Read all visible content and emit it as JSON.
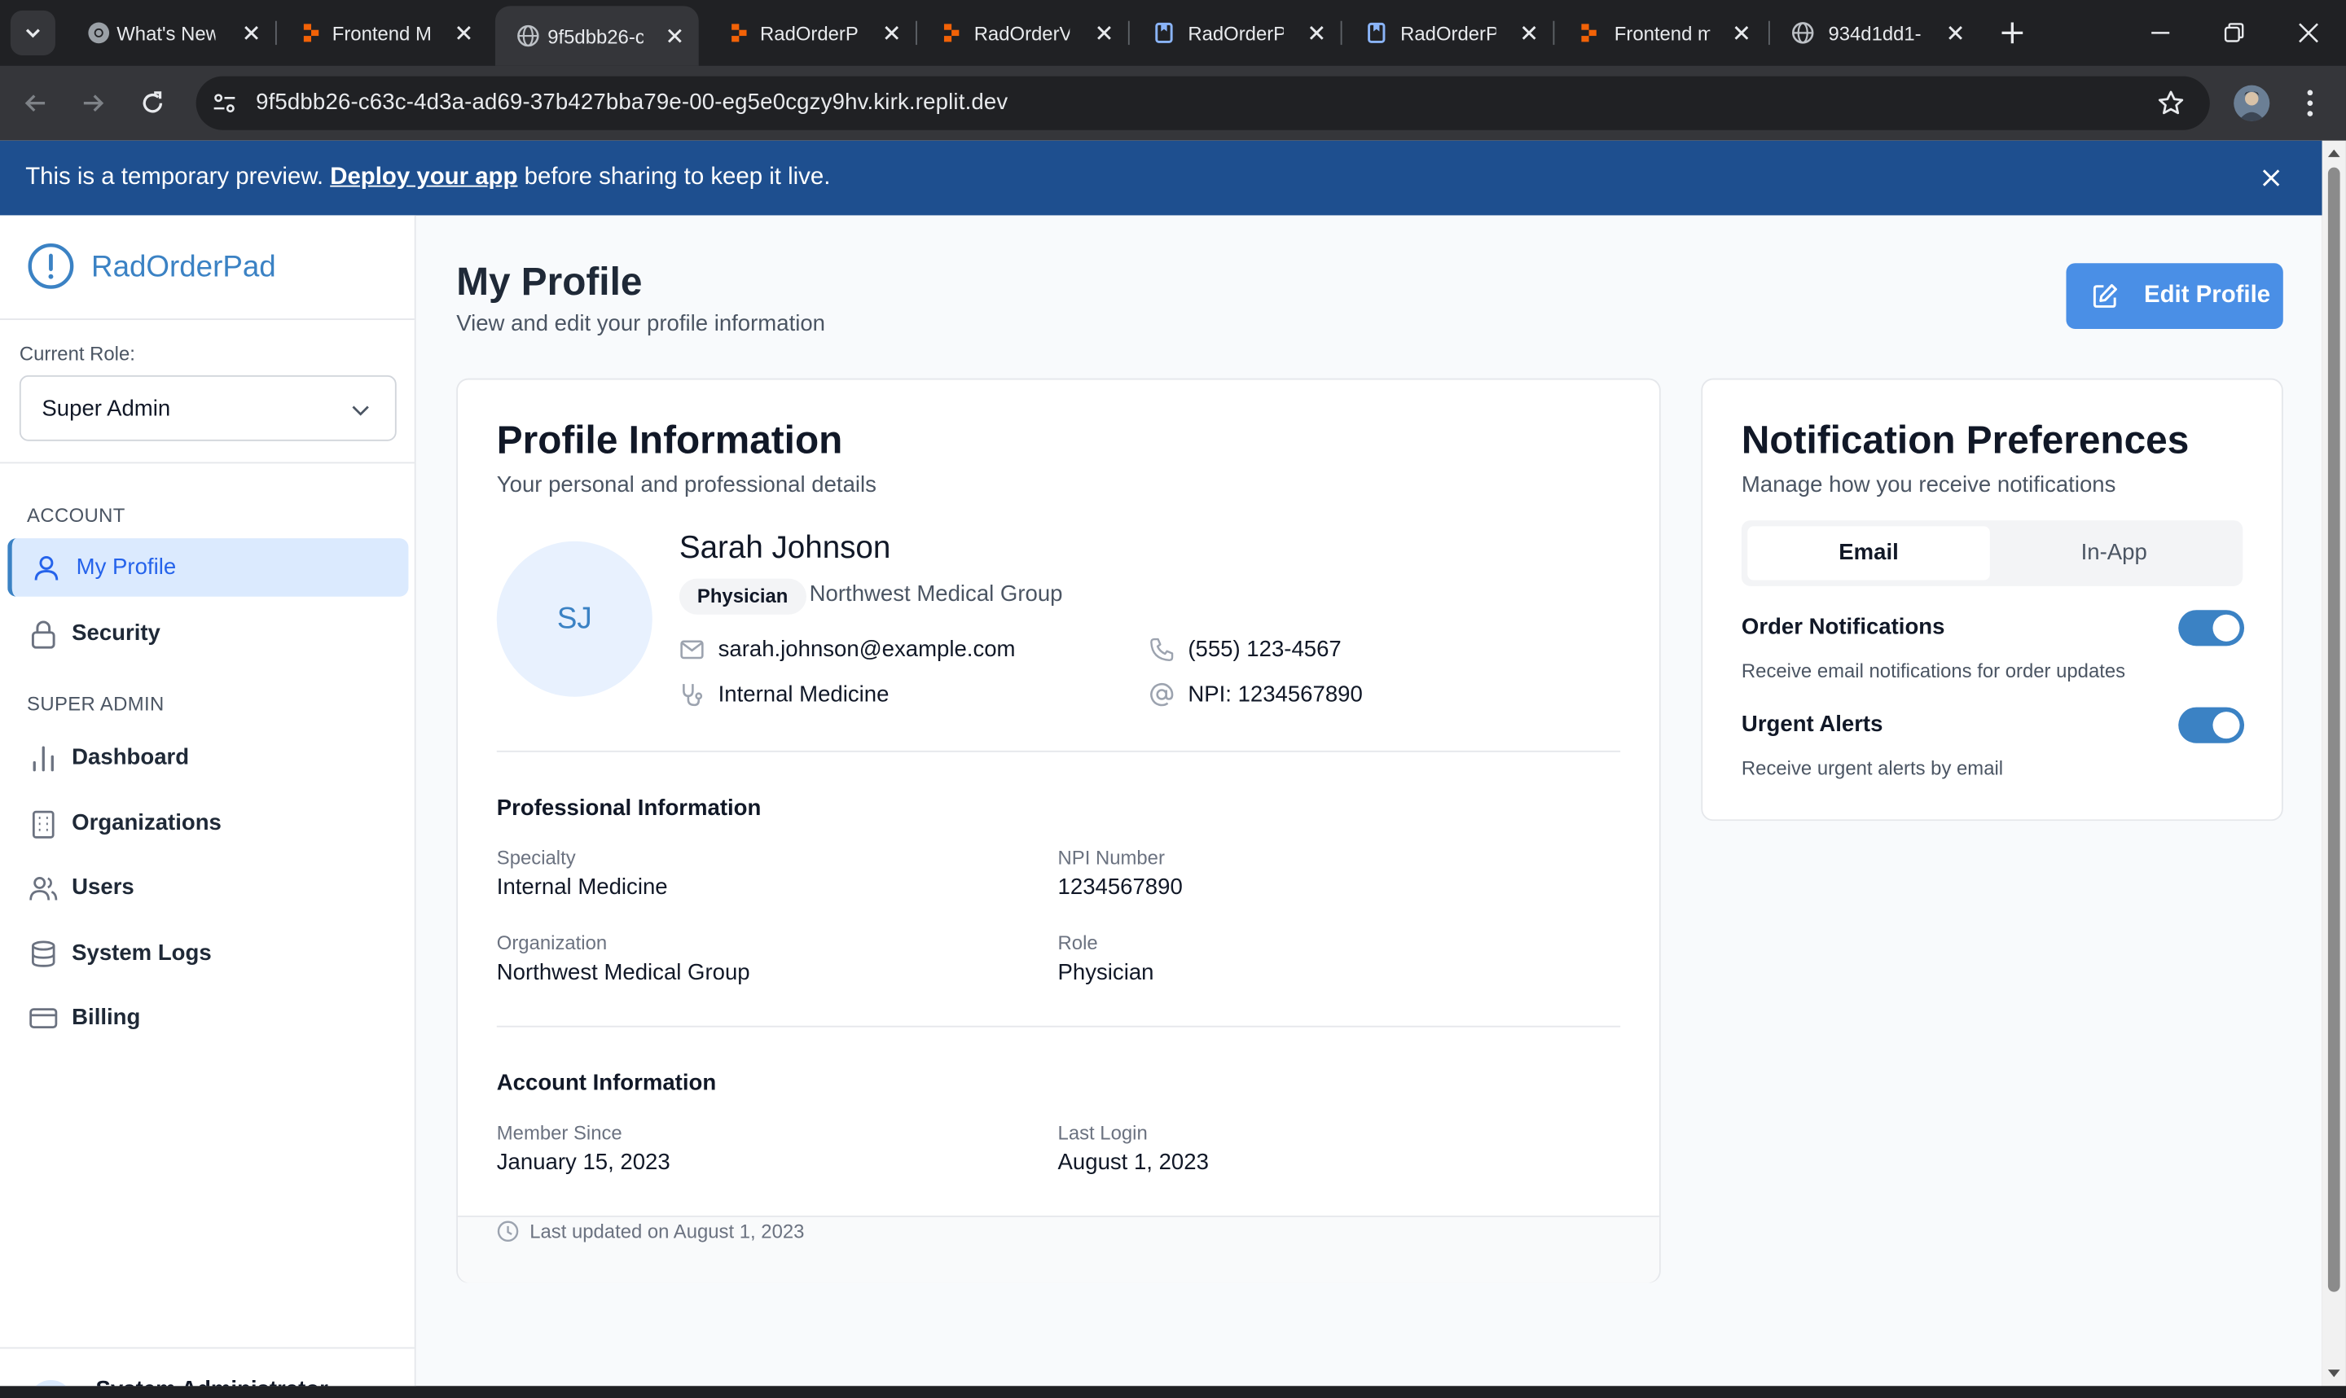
{
  "browser": {
    "tabs": [
      {
        "title": "What's New",
        "favicon": "chrome-icon"
      },
      {
        "title": "Frontend M",
        "favicon": "replit-icon"
      },
      {
        "title": "9f5dbb26-c",
        "favicon": "globe-icon",
        "active": true
      },
      {
        "title": "RadOrderP",
        "favicon": "replit-icon"
      },
      {
        "title": "RadOrderV",
        "favicon": "replit-icon"
      },
      {
        "title": "RadOrderP",
        "favicon": "doc-icon"
      },
      {
        "title": "RadOrderP",
        "favicon": "doc-icon"
      },
      {
        "title": "Frontend m",
        "favicon": "replit-icon"
      },
      {
        "title": "934d1dd1-",
        "favicon": "globe-icon"
      }
    ],
    "url": "9f5dbb26-c63c-4d3a-ad69-37b427bba79e-00-eg5e0cgzy9hv.kirk.replit.dev"
  },
  "banner": {
    "prefix": "This is a temporary preview. ",
    "link": "Deploy your app",
    "suffix": " before sharing to keep it live."
  },
  "sidebar": {
    "brand": "RadOrderPad",
    "role_label": "Current Role:",
    "role_value": "Super Admin",
    "sections": [
      {
        "title": "ACCOUNT"
      },
      {
        "title": "SUPER ADMIN"
      }
    ],
    "items": [
      {
        "label": "My Profile",
        "icon": "user-icon",
        "active": true
      },
      {
        "label": "Security",
        "icon": "lock-icon"
      },
      {
        "label": "Dashboard",
        "icon": "bar-chart-icon"
      },
      {
        "label": "Organizations",
        "icon": "building-icon"
      },
      {
        "label": "Users",
        "icon": "users-icon"
      },
      {
        "label": "System Logs",
        "icon": "database-icon"
      },
      {
        "label": "Billing",
        "icon": "credit-card-icon"
      }
    ],
    "user_name": "System Administrator"
  },
  "main": {
    "title": "My Profile",
    "subtitle": "View and edit your profile information",
    "edit_button": "Edit Profile"
  },
  "profile": {
    "card_title": "Profile Information",
    "card_subtitle": "Your personal and professional details",
    "initials": "SJ",
    "name": "Sarah Johnson",
    "role_badge": "Physician",
    "organization": "Northwest Medical Group",
    "email": "sarah.johnson@example.com",
    "phone": "(555) 123-4567",
    "specialty": "Internal Medicine",
    "npi": "NPI: 1234567890",
    "professional": {
      "title": "Professional Information",
      "fields": [
        {
          "label": "Specialty",
          "value": "Internal Medicine"
        },
        {
          "label": "NPI Number",
          "value": "1234567890"
        },
        {
          "label": "Organization",
          "value": "Northwest Medical Group"
        },
        {
          "label": "Role",
          "value": "Physician"
        }
      ]
    },
    "account": {
      "title": "Account Information",
      "fields": [
        {
          "label": "Member Since",
          "value": "January 15, 2023"
        },
        {
          "label": "Last Login",
          "value": "August 1, 2023"
        }
      ]
    },
    "footer": "Last updated on August 1, 2023"
  },
  "notifications": {
    "title": "Notification Preferences",
    "subtitle": "Manage how you receive notifications",
    "tabs": [
      "Email",
      "In-App"
    ],
    "active_tab": "Email",
    "prefs": [
      {
        "title": "Order Notifications",
        "desc": "Receive email notifications for order updates",
        "enabled": true
      },
      {
        "title": "Urgent Alerts",
        "desc": "Receive urgent alerts by email",
        "enabled": true
      }
    ]
  },
  "colors": {
    "banner": "#1e4f8f",
    "accent": "#3b82c4",
    "button": "#4a8fe6",
    "active_nav_bg": "#dbeafe"
  }
}
